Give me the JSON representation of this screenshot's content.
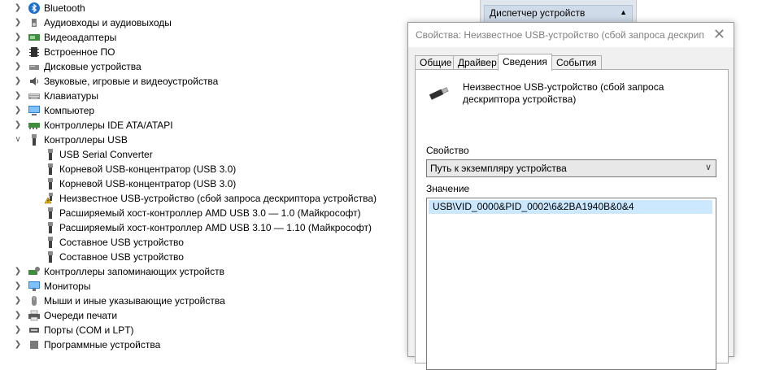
{
  "tree": {
    "items": [
      {
        "label": "Bluetooth",
        "icon": "bluetooth-icon",
        "expanded": false
      },
      {
        "label": "Аудиовходы и аудиовыходы",
        "icon": "speaker-icon",
        "expanded": false
      },
      {
        "label": "Видеоадаптеры",
        "icon": "display-adapter-icon",
        "expanded": false
      },
      {
        "label": "Встроенное ПО",
        "icon": "firmware-icon",
        "expanded": false
      },
      {
        "label": "Дисковые устройства",
        "icon": "disk-drive-icon",
        "expanded": false
      },
      {
        "label": "Звуковые, игровые и видеоустройства",
        "icon": "sound-icon",
        "expanded": false
      },
      {
        "label": "Клавиатуры",
        "icon": "keyboard-icon",
        "expanded": false
      },
      {
        "label": "Компьютер",
        "icon": "computer-icon",
        "expanded": false
      },
      {
        "label": "Контроллеры IDE ATA/ATAPI",
        "icon": "ide-controller-icon",
        "expanded": false
      },
      {
        "label": "Контроллеры USB",
        "icon": "usb-icon",
        "expanded": true
      },
      {
        "label": "Контроллеры запоминающих устройств",
        "icon": "storage-controller-icon",
        "expanded": false
      },
      {
        "label": "Мониторы",
        "icon": "monitor-icon",
        "expanded": false
      },
      {
        "label": "Мыши и иные указывающие устройства",
        "icon": "mouse-icon",
        "expanded": false
      },
      {
        "label": "Очереди печати",
        "icon": "printer-icon",
        "expanded": false
      },
      {
        "label": "Порты (COM и LPT)",
        "icon": "port-icon",
        "expanded": false
      },
      {
        "label": "Программные устройства",
        "icon": "software-device-icon",
        "expanded": false
      }
    ],
    "usb_children": [
      {
        "label": "USB Serial Converter",
        "icon": "usb-plug-icon"
      },
      {
        "label": "Корневой USB-концентратор (USB 3.0)",
        "icon": "usb-plug-icon"
      },
      {
        "label": "Корневой USB-концентратор (USB 3.0)",
        "icon": "usb-plug-icon"
      },
      {
        "label": "Неизвестное USB-устройство (сбой запроса дескриптора устройства)",
        "icon": "warning-usb-icon"
      },
      {
        "label": "Расширяемый хост-контроллер AMD USB 3.0 — 1.0 (Майкрософт)",
        "icon": "usb-plug-icon"
      },
      {
        "label": "Расширяемый хост-контроллер AMD USB 3.10 — 1.10 (Майкрософт)",
        "icon": "usb-plug-icon"
      },
      {
        "label": "Составное USB устройство",
        "icon": "usb-plug-icon"
      },
      {
        "label": "Составное USB устройство",
        "icon": "usb-plug-icon"
      }
    ]
  },
  "popup": {
    "title": "Диспетчер устройств"
  },
  "dialog": {
    "title": "Свойства: Неизвестное USB-устройство (сбой запроса дескрип",
    "tabs": [
      {
        "label": "Общие"
      },
      {
        "label": "Драйвер"
      },
      {
        "label": "Сведения"
      },
      {
        "label": "События"
      }
    ],
    "active_tab": "Сведения",
    "device_name": "Неизвестное USB-устройство (сбой запроса дескриптора устройства)",
    "property_label": "Свойство",
    "property_value": "Путь к экземпляру устройства",
    "value_label": "Значение",
    "value_item": "USB\\VID_0000&PID_0002\\6&2BA1940B&0&4"
  },
  "colors": {
    "selection": "#cce8ff",
    "dialog_bg": "#f0f0f0",
    "warning": "#f2c200"
  }
}
